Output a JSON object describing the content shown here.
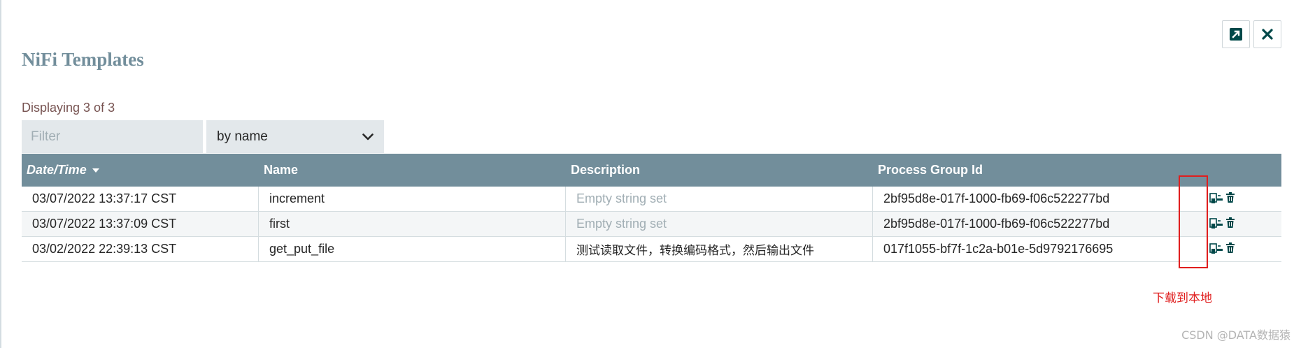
{
  "dialog": {
    "title": "NiFi Templates",
    "open_button_icon": "external-link-icon",
    "close_button_icon": "close-icon"
  },
  "summary": {
    "displaying": "Displaying 3 of 3"
  },
  "filter": {
    "placeholder": "Filter",
    "value": "",
    "by_label": "by name"
  },
  "table": {
    "columns": [
      "Date/Time",
      "Name",
      "Description",
      "Process Group Id"
    ],
    "sort_indicator": "sort-down-icon",
    "rows": [
      {
        "datetime": "03/07/2022 13:37:17 CST",
        "name": "increment",
        "description": "Empty string set",
        "group_id": "2bf95d8e-017f-1000-fb69-f06c522277bd"
      },
      {
        "datetime": "03/07/2022 13:37:09 CST",
        "name": "first",
        "description": "Empty string set",
        "group_id": "2bf95d8e-017f-1000-fb69-f06c522277bd"
      },
      {
        "datetime": "03/02/2022 22:39:13 CST",
        "name": "get_put_file",
        "description": "测试读取文件，转换编码格式，然后输出文件",
        "group_id": "017f1055-bf7f-1c2a-b01e-5d9792176695"
      }
    ]
  },
  "annotation": {
    "text": "下载到本地",
    "color": "#e01e1e"
  },
  "watermark": {
    "text": "CSDN @DATA数据猿"
  },
  "colors": {
    "header_bg": "#728e9b",
    "title": "#728e9b",
    "count_text": "#775351",
    "control_bg": "#e3e8eb"
  }
}
